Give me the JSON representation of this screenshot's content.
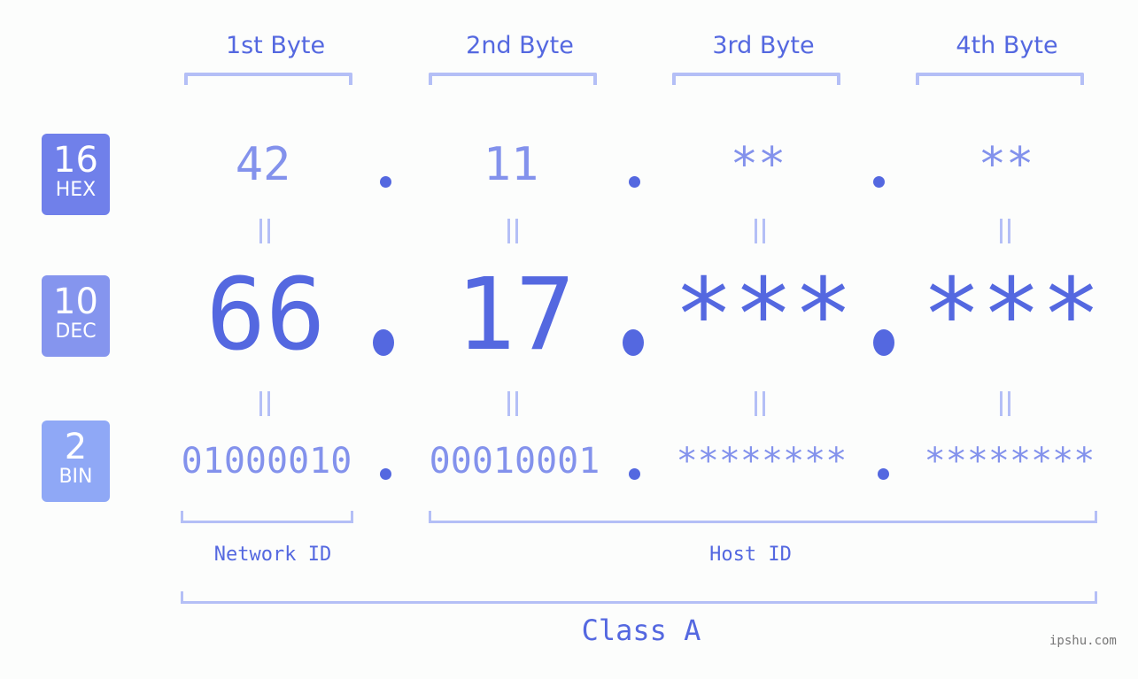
{
  "headers": [
    "1st Byte",
    "2nd Byte",
    "3rd Byte",
    "4th Byte"
  ],
  "bases": [
    {
      "number": "16",
      "label": "HEX"
    },
    {
      "number": "10",
      "label": "DEC"
    },
    {
      "number": "2",
      "label": "BIN"
    }
  ],
  "separator": ".",
  "hex": [
    "42",
    "11",
    "**",
    "**"
  ],
  "dec": [
    "66",
    "17",
    "***",
    "***"
  ],
  "bin": [
    "01000010",
    "00010001",
    "********",
    "********"
  ],
  "network_label": "Network ID",
  "host_label": "Host ID",
  "class_label": "Class A",
  "watermark": "ipshu.com",
  "colors": {
    "accent": "#5468e0",
    "light_value": "#8392ec",
    "bracket": "#b4bff6",
    "badge_hex": "#7080ea",
    "badge_dec": "#8595ee",
    "badge_bin": "#8fa8f6"
  }
}
